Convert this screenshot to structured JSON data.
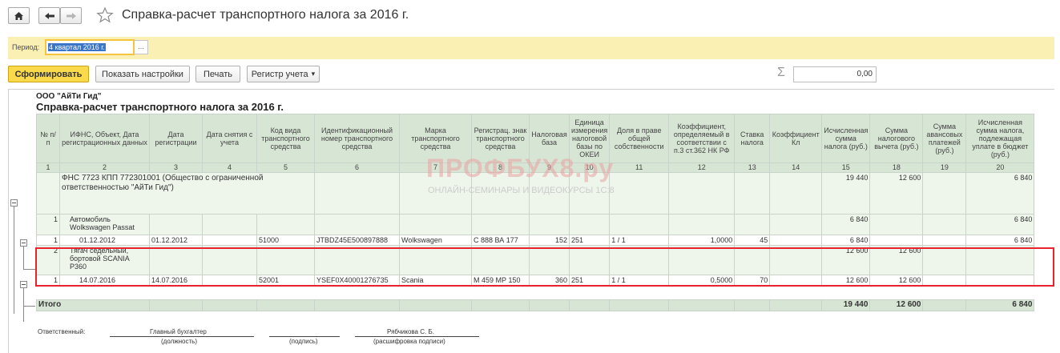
{
  "window": {
    "title": "Справка-расчет транспортного налога за 2016 г.",
    "icons": [
      "home-icon",
      "back-arrow-icon",
      "forward-arrow-icon",
      "star-icon"
    ]
  },
  "period": {
    "label": "Период:",
    "value": "4 квартал 2016 г.",
    "choose": "..."
  },
  "toolbar": {
    "generate": "Сформировать",
    "settings": "Показать настройки",
    "print": "Печать",
    "register": "Регистр учета",
    "register_arrow": "▾",
    "sigma": "Σ",
    "sum": "0,00"
  },
  "report": {
    "org": "ООО \"АйТи Гид\"",
    "title": "Справка-расчет транспортного налога за 2016 г.",
    "columns": [
      "№ п/п",
      "ИФНС, Объект, Дата регистрационных данных",
      "Дата регистрации",
      "Дата снятия с учета",
      "Код вида транспортного средства",
      "Идентификационный номер транспортного средства",
      "Марка транспортного средства",
      "Регистрац. знак транспортного средства",
      "Налоговая база",
      "Единица измерения налоговой базы по ОКЕИ",
      "Доля в праве общей собственности",
      "Коэффициент, определяемый в соответствии с п.3 ст.362 НК РФ",
      "Ставка налога",
      "Коэффициент Кл",
      "Исчисленная сумма налога (руб.)",
      "Сумма налогового вычета (руб.)",
      "Сумма авансовых платежей (руб.)",
      "Исчисленная сумма налога, подлежащая уплате в бюджет (руб.)"
    ],
    "col_numbers": [
      "1",
      "2",
      "3",
      "4",
      "5",
      "6",
      "7",
      "8",
      "9",
      "10",
      "11",
      "12",
      "13",
      "14",
      "15",
      "18",
      "19",
      "20"
    ],
    "group": {
      "name": "ФНС 7723 КПП 772301001 (Общество с ограниченной ответственностью \"АйТи Гид\")",
      "tax": "19 440",
      "deduction": "12 600",
      "payable": "6 840"
    },
    "objects": [
      {
        "n": "1",
        "name": "Автомобиль Wolkswagen Passat",
        "tax": "6 840",
        "deduction": "",
        "payable": "6 840",
        "detail": {
          "n": "1",
          "date": "01.12.2012",
          "reg_date": "01.12.2012",
          "unreg_date": "",
          "kind_code": "51000",
          "vin": "JTBDZ45E500897888",
          "brand": "Wolkswagen",
          "plate": "С 888 ВА 177",
          "base": "152",
          "okei": "251",
          "share": "1 / 1",
          "coef": "1,0000",
          "rate": "45",
          "kl": "",
          "tax": "6 840",
          "deduction": "",
          "advance": "",
          "payable": "6 840"
        }
      },
      {
        "n": "2",
        "name": "Тягач седельный, бортовой SCANIA P360",
        "tax": "12 600",
        "deduction": "12 600",
        "payable": "",
        "detail": {
          "n": "1",
          "date": "14.07.2016",
          "reg_date": "14.07.2016",
          "unreg_date": "",
          "kind_code": "52001",
          "vin": "YSEF0X40001276735",
          "brand": "Scania",
          "plate": "М 459 МР 150",
          "base": "360",
          "okei": "251",
          "share": "1 / 1",
          "coef": "0,5000",
          "rate": "70",
          "kl": "",
          "tax": "12 600",
          "deduction": "12 600",
          "advance": "",
          "payable": ""
        }
      }
    ],
    "total": {
      "label": "Итого",
      "tax": "19 440",
      "deduction": "12 600",
      "payable": "6 840"
    },
    "signature": {
      "responsible": "Ответственный:",
      "position_value": "Главный бухгалтер",
      "position_caption": "(должность)",
      "sign_caption": "(подпись)",
      "name_value": "Рябчикова С. Б.",
      "name_caption": "(расшифровка подписи)"
    }
  },
  "watermark": {
    "brand": "ПРОФБУХ8.ру",
    "subtitle": "ОНЛАЙН-СЕМИНАРЫ И ВИДЕОКУРСЫ 1С:8"
  },
  "colors": {
    "header_bg": "#d7e6d4",
    "primary_button": "#fad94b",
    "period_panel": "#faf0b4",
    "highlight_box": "#e8232e"
  }
}
